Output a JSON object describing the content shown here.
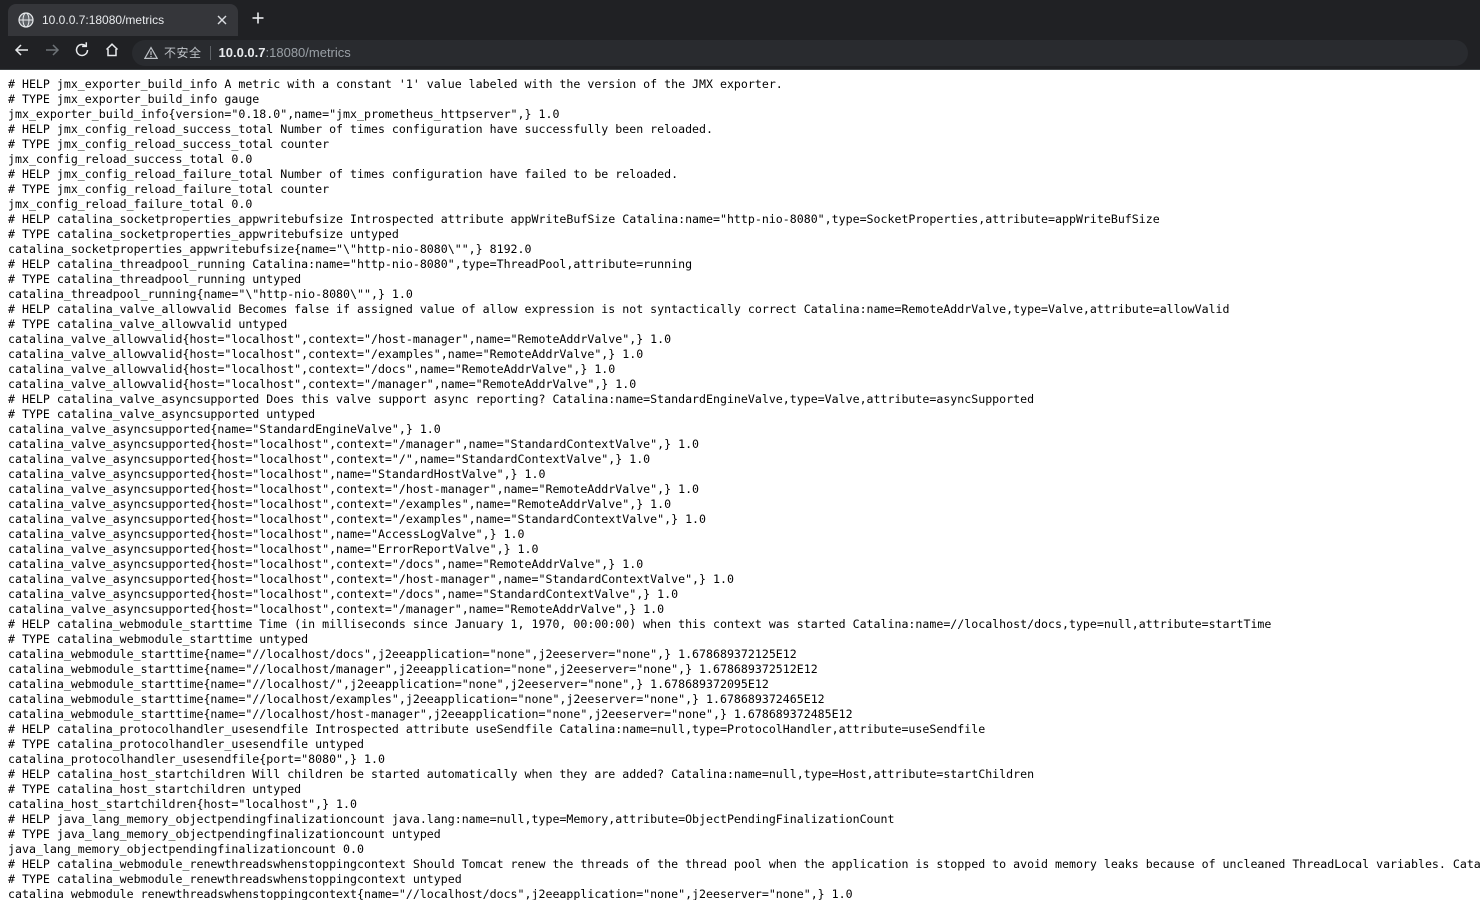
{
  "browser": {
    "tab": {
      "title": "10.0.0.7:18080/metrics",
      "favicon_icon": "globe-icon",
      "close_icon": "close-icon"
    },
    "new_tab_icon": "plus-icon",
    "toolbar": {
      "back_icon": "arrow-left-icon",
      "forward_icon": "arrow-right-icon",
      "reload_icon": "reload-icon",
      "home_icon": "home-icon",
      "security_icon": "warning-triangle-icon",
      "security_label": "不安全",
      "url_host": "10.0.0.7",
      "url_path": ":18080/metrics"
    },
    "colors": {
      "chrome_bg": "#202124",
      "tab_active_bg": "#35363a",
      "omnibox_bg": "#292b2f",
      "text_primary": "#e8eaed",
      "text_secondary": "#9aa0a6",
      "page_bg": "#ffffff",
      "page_text": "#000000"
    }
  },
  "page": {
    "content_lines": [
      "# HELP jmx_exporter_build_info A metric with a constant '1' value labeled with the version of the JMX exporter.",
      "# TYPE jmx_exporter_build_info gauge",
      "jmx_exporter_build_info{version=\"0.18.0\",name=\"jmx_prometheus_httpserver\",} 1.0",
      "# HELP jmx_config_reload_success_total Number of times configuration have successfully been reloaded.",
      "# TYPE jmx_config_reload_success_total counter",
      "jmx_config_reload_success_total 0.0",
      "# HELP jmx_config_reload_failure_total Number of times configuration have failed to be reloaded.",
      "# TYPE jmx_config_reload_failure_total counter",
      "jmx_config_reload_failure_total 0.0",
      "# HELP catalina_socketproperties_appwritebufsize Introspected attribute appWriteBufSize Catalina:name=\"http-nio-8080\",type=SocketProperties,attribute=appWriteBufSize",
      "# TYPE catalina_socketproperties_appwritebufsize untyped",
      "catalina_socketproperties_appwritebufsize{name=\"\\\"http-nio-8080\\\"\",} 8192.0",
      "# HELP catalina_threadpool_running Catalina:name=\"http-nio-8080\",type=ThreadPool,attribute=running",
      "# TYPE catalina_threadpool_running untyped",
      "catalina_threadpool_running{name=\"\\\"http-nio-8080\\\"\",} 1.0",
      "# HELP catalina_valve_allowvalid Becomes false if assigned value of allow expression is not syntactically correct Catalina:name=RemoteAddrValve,type=Valve,attribute=allowValid",
      "# TYPE catalina_valve_allowvalid untyped",
      "catalina_valve_allowvalid{host=\"localhost\",context=\"/host-manager\",name=\"RemoteAddrValve\",} 1.0",
      "catalina_valve_allowvalid{host=\"localhost\",context=\"/examples\",name=\"RemoteAddrValve\",} 1.0",
      "catalina_valve_allowvalid{host=\"localhost\",context=\"/docs\",name=\"RemoteAddrValve\",} 1.0",
      "catalina_valve_allowvalid{host=\"localhost\",context=\"/manager\",name=\"RemoteAddrValve\",} 1.0",
      "# HELP catalina_valve_asyncsupported Does this valve support async reporting? Catalina:name=StandardEngineValve,type=Valve,attribute=asyncSupported",
      "# TYPE catalina_valve_asyncsupported untyped",
      "catalina_valve_asyncsupported{name=\"StandardEngineValve\",} 1.0",
      "catalina_valve_asyncsupported{host=\"localhost\",context=\"/manager\",name=\"StandardContextValve\",} 1.0",
      "catalina_valve_asyncsupported{host=\"localhost\",context=\"/\",name=\"StandardContextValve\",} 1.0",
      "catalina_valve_asyncsupported{host=\"localhost\",name=\"StandardHostValve\",} 1.0",
      "catalina_valve_asyncsupported{host=\"localhost\",context=\"/host-manager\",name=\"RemoteAddrValve\",} 1.0",
      "catalina_valve_asyncsupported{host=\"localhost\",context=\"/examples\",name=\"RemoteAddrValve\",} 1.0",
      "catalina_valve_asyncsupported{host=\"localhost\",context=\"/examples\",name=\"StandardContextValve\",} 1.0",
      "catalina_valve_asyncsupported{host=\"localhost\",name=\"AccessLogValve\",} 1.0",
      "catalina_valve_asyncsupported{host=\"localhost\",name=\"ErrorReportValve\",} 1.0",
      "catalina_valve_asyncsupported{host=\"localhost\",context=\"/docs\",name=\"RemoteAddrValve\",} 1.0",
      "catalina_valve_asyncsupported{host=\"localhost\",context=\"/host-manager\",name=\"StandardContextValve\",} 1.0",
      "catalina_valve_asyncsupported{host=\"localhost\",context=\"/docs\",name=\"StandardContextValve\",} 1.0",
      "catalina_valve_asyncsupported{host=\"localhost\",context=\"/manager\",name=\"RemoteAddrValve\",} 1.0",
      "# HELP catalina_webmodule_starttime Time (in milliseconds since January 1, 1970, 00:00:00) when this context was started Catalina:name=//localhost/docs,type=null,attribute=startTime",
      "# TYPE catalina_webmodule_starttime untyped",
      "catalina_webmodule_starttime{name=\"//localhost/docs\",j2eeapplication=\"none\",j2eeserver=\"none\",} 1.678689372125E12",
      "catalina_webmodule_starttime{name=\"//localhost/manager\",j2eeapplication=\"none\",j2eeserver=\"none\",} 1.678689372512E12",
      "catalina_webmodule_starttime{name=\"//localhost/\",j2eeapplication=\"none\",j2eeserver=\"none\",} 1.678689372095E12",
      "catalina_webmodule_starttime{name=\"//localhost/examples\",j2eeapplication=\"none\",j2eeserver=\"none\",} 1.678689372465E12",
      "catalina_webmodule_starttime{name=\"//localhost/host-manager\",j2eeapplication=\"none\",j2eeserver=\"none\",} 1.678689372485E12",
      "# HELP catalina_protocolhandler_usesendfile Introspected attribute useSendfile Catalina:name=null,type=ProtocolHandler,attribute=useSendfile",
      "# TYPE catalina_protocolhandler_usesendfile untyped",
      "catalina_protocolhandler_usesendfile{port=\"8080\",} 1.0",
      "# HELP catalina_host_startchildren Will children be started automatically when they are added? Catalina:name=null,type=Host,attribute=startChildren",
      "# TYPE catalina_host_startchildren untyped",
      "catalina_host_startchildren{host=\"localhost\",} 1.0",
      "# HELP java_lang_memory_objectpendingfinalizationcount java.lang:name=null,type=Memory,attribute=ObjectPendingFinalizationCount",
      "# TYPE java_lang_memory_objectpendingfinalizationcount untyped",
      "java_lang_memory_objectpendingfinalizationcount 0.0",
      "# HELP catalina_webmodule_renewthreadswhenstoppingcontext Should Tomcat renew the threads of the thread pool when the application is stopped to avoid memory leaks because of uncleaned ThreadLocal variables. Catalina:name=//localhost/docs,type=null,attribute=renewThreadsWhenStoppingContext",
      "# TYPE catalina_webmodule_renewthreadswhenstoppingcontext untyped",
      "catalina_webmodule_renewthreadswhenstoppingcontext{name=\"//localhost/docs\",j2eeapplication=\"none\",j2eeserver=\"none\",} 1.0"
    ]
  }
}
